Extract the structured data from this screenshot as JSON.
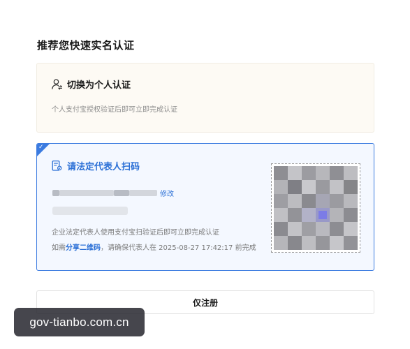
{
  "page": {
    "title": "推荐您快速实名认证"
  },
  "personal_option": {
    "icon": "user-switch-icon",
    "title": "切换为个人认证",
    "description": "个人支付宝授权验证后即可立即完成认证",
    "selected": false
  },
  "legal_option": {
    "icon": "document-scan-icon",
    "title": "请法定代表人扫码",
    "edit_label": "修改",
    "description": "企业法定代表人使用支付宝扫验证后即可立即完成认证",
    "share_prefix": "如需",
    "share_link": "分享二维码",
    "share_suffix": "，请确保代表人在 2025-08-27 17:42:17 前完成",
    "selected": true,
    "qr_icon": "qr-code-icon"
  },
  "register_button": {
    "label": "仅注册"
  },
  "watermark": {
    "text": "gov-tianbo.com.cn"
  },
  "colors": {
    "accent": "#2a6fd6",
    "selected_border": "#3b7be0",
    "personal_bg": "#fdfaf4",
    "selected_bg": "#f4f8ff"
  }
}
